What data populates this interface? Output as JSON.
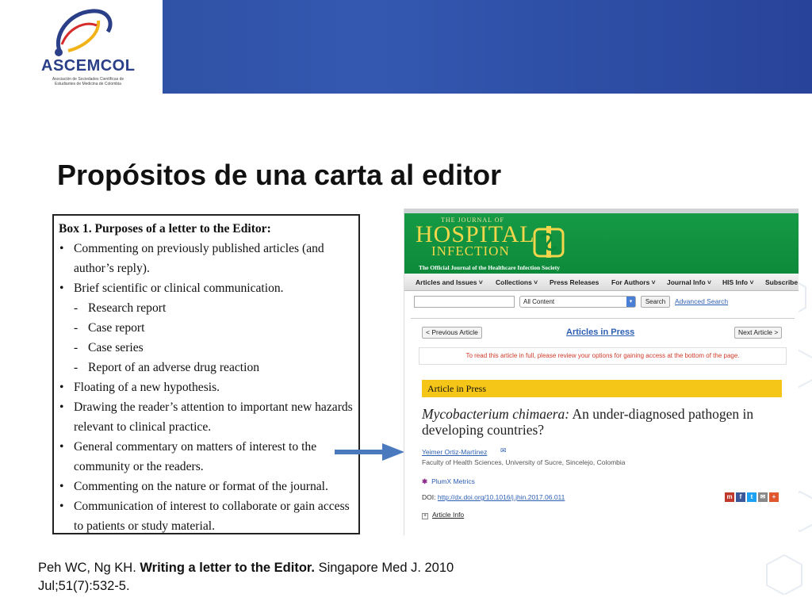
{
  "header": {
    "logo_word": "ASCEMCOL",
    "logo_sub": "Asociación de Sociedades Científicas de Estudiantes de Medicina de Colombia"
  },
  "slide": {
    "title": "Propósitos de una carta al editor"
  },
  "box": {
    "title": "Box 1. Purposes of a letter to the Editor:",
    "items": [
      {
        "type": "bullet",
        "text": "Commenting on previously published articles (and author’s reply)."
      },
      {
        "type": "bullet",
        "text": "Brief scientific or clinical communication."
      },
      {
        "type": "sub",
        "text": "Research report"
      },
      {
        "type": "sub",
        "text": "Case report"
      },
      {
        "type": "sub",
        "text": "Case series"
      },
      {
        "type": "sub",
        "text": "Report of an adverse drug reaction"
      },
      {
        "type": "bullet",
        "text": "Floating of a new hypothesis."
      },
      {
        "type": "bullet",
        "text": "Drawing the reader’s attention to important new hazards relevant to clinical practice."
      },
      {
        "type": "bullet",
        "text": "General commentary on matters of interest to the community or the readers."
      },
      {
        "type": "bullet",
        "text": "Commenting on the nature or format of the journal."
      },
      {
        "type": "bullet",
        "text": "Communication of interest to collaborate or gain access to patients or study material."
      }
    ]
  },
  "journal": {
    "small": "THE JOURNAL OF",
    "name1": "HOSPITAL",
    "name2": "INFECTION",
    "tagline": "The Official Journal of the Healthcare Infection Society",
    "nav": [
      "Articles and Issues ˅",
      "Collections ˅",
      "Press Releases",
      "For Authors ˅",
      "Journal Info ˅",
      "HIS Info ˅",
      "Subscribe"
    ],
    "search_select": "All Content",
    "search_button": "Search",
    "advanced_search": "Advanced Search",
    "prev": "< Previous Article",
    "articles_in_press": "Articles in Press",
    "next": "Next Article >",
    "notice": "To read this article in full, please review your options for gaining access at the bottom of the page.",
    "bar": "Article in Press",
    "article_title_italic": "Mycobacterium chimaera:",
    "article_title_rest": " An under-diagnosed pathogen in developing countries?",
    "author": "Yeimer Ortiz-Martínez",
    "affiliation": "Faculty of Health Sciences, University of Sucre, Sincelejo, Colombia",
    "plumx": "PlumX Metrics",
    "doi_label": "DOI: ",
    "doi_link": "http://dx.doi.org/10.1016/j.jhin.2017.06.011",
    "article_info": "Article Info",
    "share_colors": [
      "#c0392b",
      "#3b5998",
      "#1da1f2",
      "#888888",
      "#e0562f"
    ]
  },
  "citation": {
    "authors": "Peh WC, Ng KH. ",
    "title": "Writing a letter to the Editor.",
    "source": " Singapore Med J. 2010 Jul;51(7):532-5."
  }
}
